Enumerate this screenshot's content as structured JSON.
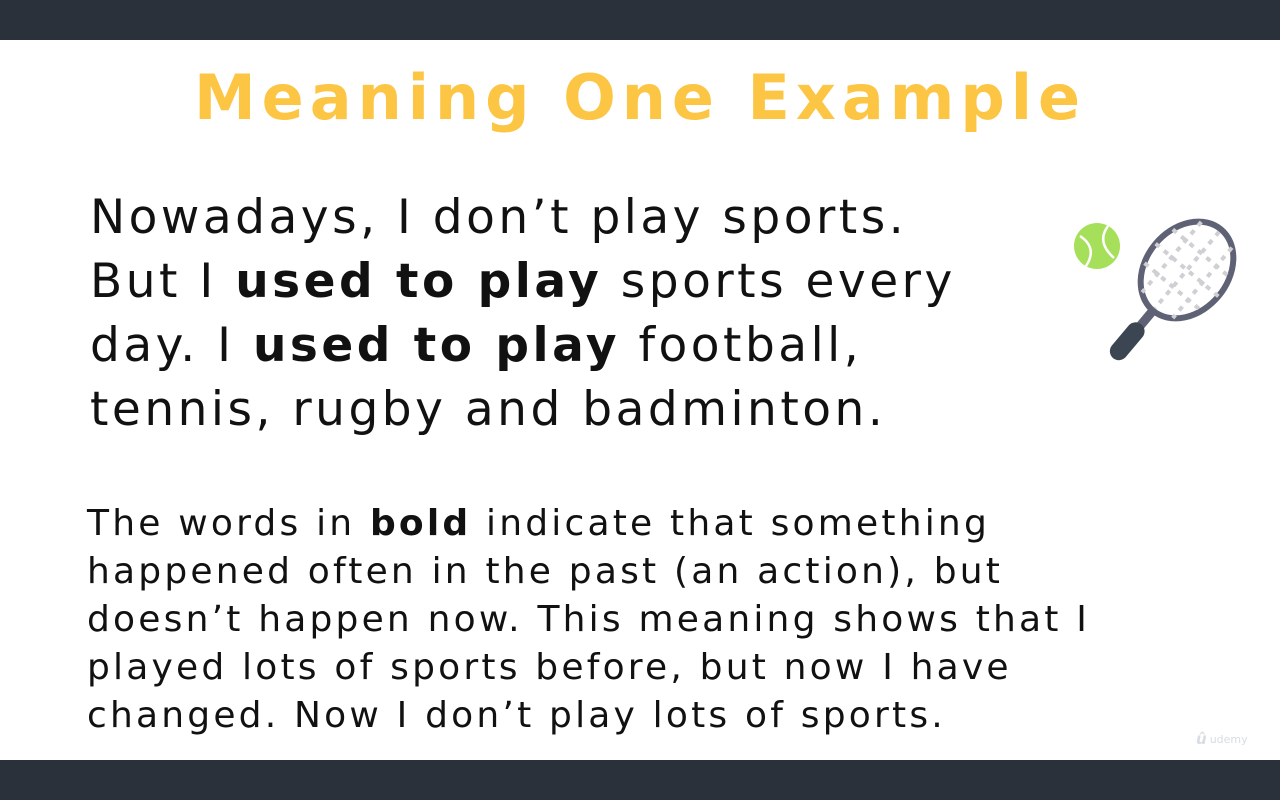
{
  "slide": {
    "title": "Meaning One Example",
    "example_lines": [
      {
        "parts": [
          "Nowadays, I don’t play sports."
        ]
      },
      {
        "pre": "But I ",
        "bold": "used to play",
        "post": " sports every"
      },
      {
        "pre": "day. I ",
        "bold": "used to play",
        "post": " football,"
      },
      {
        "parts": [
          "tennis, rugby and badminton."
        ]
      }
    ],
    "explanation_lines": [
      {
        "pre": "The words in ",
        "bold": "bold",
        "post": " indicate that something"
      },
      {
        "parts": [
          "happened often in the past (an action), but"
        ]
      },
      {
        "parts": [
          "doesn’t happen now. This meaning shows that I"
        ]
      },
      {
        "parts": [
          "played lots of sports before, but now I have"
        ]
      },
      {
        "parts": [
          "changed. Now I don’t play lots of sports."
        ]
      }
    ]
  },
  "illustration": {
    "icon": "tennis-racket-and-ball-icon",
    "colors": {
      "ball": "#a6e05a",
      "frame": "#5f6275",
      "handle": "#3b4652",
      "strings": "#cfcfd4"
    }
  },
  "watermark": {
    "text": "udemy"
  },
  "colors": {
    "title": "#fcc543",
    "bars": "#2a313b",
    "text": "#111111"
  }
}
